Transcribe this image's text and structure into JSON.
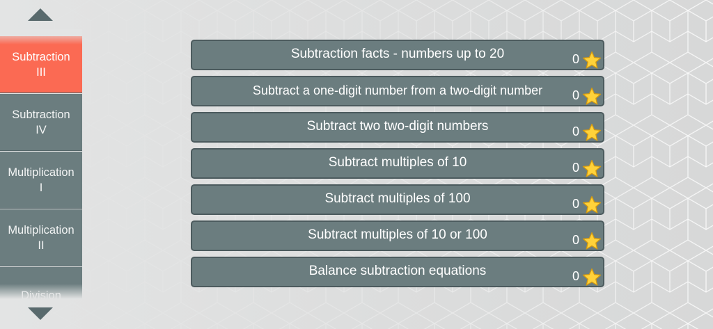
{
  "sidebar": {
    "items": [
      {
        "label": "Subtraction\nIII",
        "active": true
      },
      {
        "label": "Subtraction\nIV",
        "active": false
      },
      {
        "label": "Multiplication\nI",
        "active": false
      },
      {
        "label": "Multiplication\nII",
        "active": false
      },
      {
        "label": "Division",
        "active": false
      }
    ],
    "scroll_up_icon": "triangle-up-icon",
    "scroll_down_icon": "triangle-down-icon"
  },
  "skills": [
    {
      "label": "Subtraction facts - numbers up to 20",
      "score": "0"
    },
    {
      "label": "Subtract a one-digit number from a two-digit number",
      "score": "0"
    },
    {
      "label": "Subtract two two-digit numbers",
      "score": "0"
    },
    {
      "label": "Subtract multiples of 10",
      "score": "0"
    },
    {
      "label": "Subtract multiples of 100",
      "score": "0"
    },
    {
      "label": "Subtract multiples of 10 or 100",
      "score": "0"
    },
    {
      "label": "Balance subtraction equations",
      "score": "0"
    }
  ],
  "colors": {
    "active_tab": "#fb6a53",
    "tab": "#6b7d7f",
    "row": "#6b7d7f",
    "star": "#ffd23a"
  }
}
